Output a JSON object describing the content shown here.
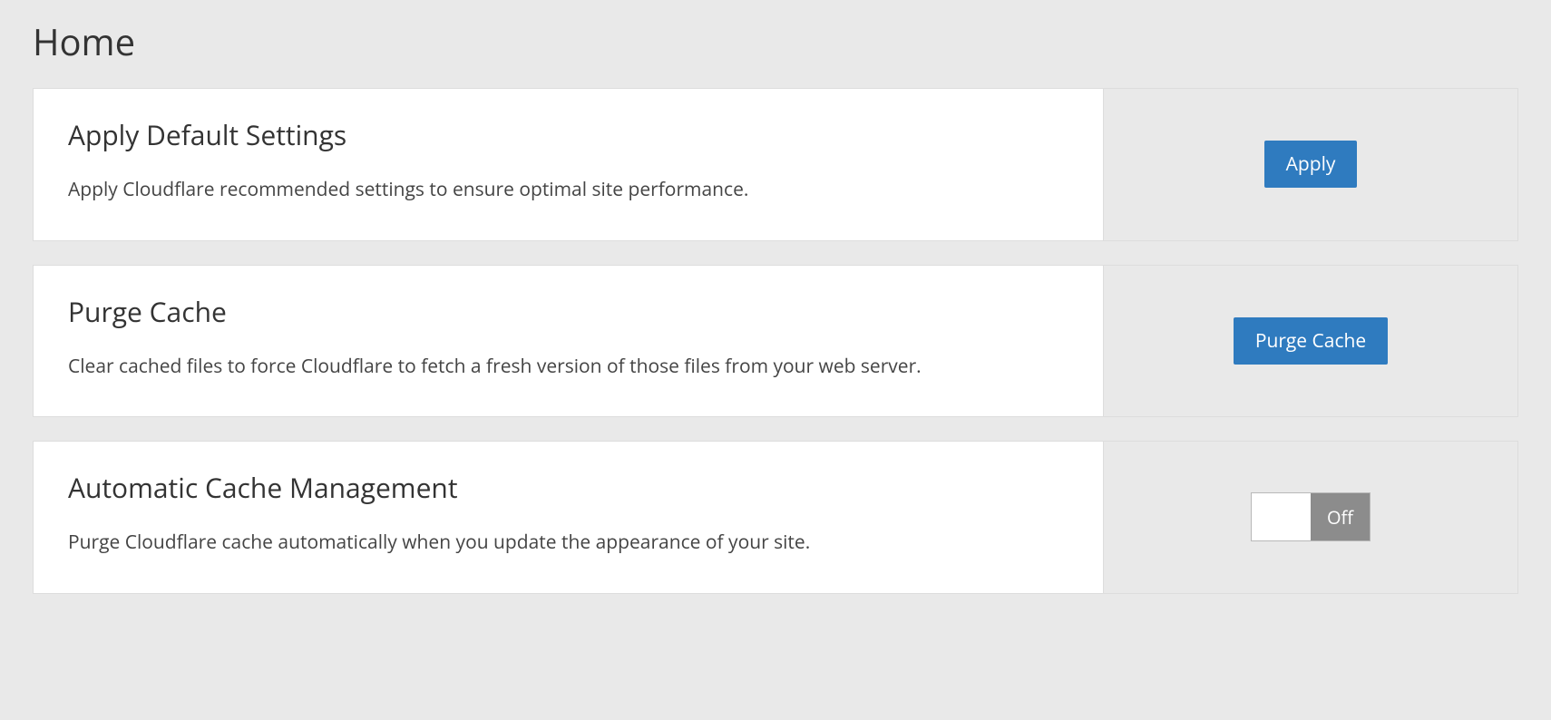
{
  "page": {
    "title": "Home"
  },
  "cards": {
    "apply_default": {
      "heading": "Apply Default Settings",
      "description": "Apply Cloudflare recommended settings to ensure optimal site performance.",
      "button_label": "Apply"
    },
    "purge_cache": {
      "heading": "Purge Cache",
      "description": "Clear cached files to force Cloudflare to fetch a fresh version of those files from your web server.",
      "button_label": "Purge Cache"
    },
    "auto_cache": {
      "heading": "Automatic Cache Management",
      "description": "Purge Cloudflare cache automatically when you update the appearance of your site.",
      "toggle_label": "Off"
    }
  },
  "colors": {
    "primary": "#2f7bbf",
    "page_bg": "#e9e9e9",
    "toggle_off": "#8c8c8c"
  }
}
